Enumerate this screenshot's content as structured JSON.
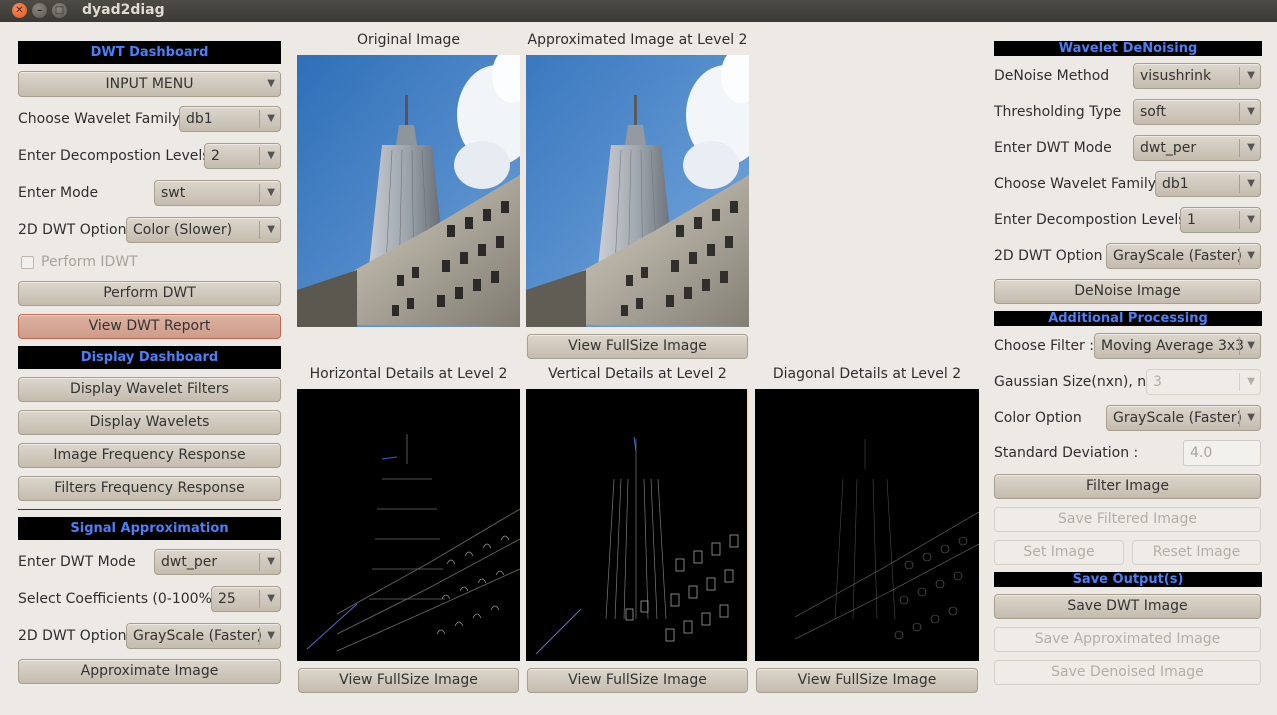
{
  "window": {
    "title": "dyad2diag",
    "close_icon": "close-icon",
    "minimize_icon": "minimize-icon",
    "maximize_icon": "maximize-icon"
  },
  "left": {
    "dwt_dashboard": {
      "header": "DWT Dashboard",
      "input_menu": "INPUT MENU",
      "wavelet_family_label": "Choose Wavelet Family",
      "wavelet_family_value": "db1",
      "decomp_levels_label": "Enter Decompostion Levels",
      "decomp_levels_value": "2",
      "mode_label": "Enter Mode",
      "mode_value": "swt",
      "dwt_option_label": "2D DWT Option",
      "dwt_option_value": "Color (Slower)",
      "perform_idwt_label": "Perform IDWT",
      "perform_dwt_button": "Perform DWT",
      "view_report_button": "View DWT Report"
    },
    "display_dashboard": {
      "header": "Display Dashboard",
      "buttons": [
        "Display Wavelet Filters",
        "Display Wavelets",
        "Image Frequency Response",
        "Filters Frequency Response"
      ]
    },
    "signal_approximation": {
      "header": "Signal Approximation",
      "dwt_mode_label": "Enter DWT Mode",
      "dwt_mode_value": "dwt_per",
      "coefficients_label": "Select Coefficients (0-100%)",
      "coefficients_value": "25",
      "dwt_option_label": "2D DWT Option",
      "dwt_option_value": "GrayScale (Faster)",
      "approximate_button": "Approximate Image"
    }
  },
  "center": {
    "original_caption": "Original Image",
    "approx_caption": "Approximated Image at Level 2",
    "horizontal_caption": "Horizontal Details at Level 2",
    "vertical_caption": "Vertical Details at Level 2",
    "diagonal_caption": "Diagonal Details at Level 2",
    "view_fullsize_button": "View FullSize Image"
  },
  "right": {
    "denoising": {
      "header": "Wavelet DeNoising",
      "method_label": "DeNoise Method",
      "method_value": "visushrink",
      "threshold_label": "Thresholding Type",
      "threshold_value": "soft",
      "dwt_mode_label": "Enter DWT Mode",
      "dwt_mode_value": "dwt_per",
      "wavelet_family_label": "Choose Wavelet Family",
      "wavelet_family_value": "db1",
      "decomp_levels_label": "Enter Decompostion Levels",
      "decomp_levels_value": "1",
      "dwt_option_label": "2D DWT Option",
      "dwt_option_value": "GrayScale (Faster)",
      "denoise_button": "DeNoise Image"
    },
    "additional": {
      "header": "Additional Processing",
      "filter_label": "Choose Filter :",
      "filter_value": "Moving Average 3x3",
      "gaussian_label": "Gaussian Size(nxn), n:",
      "gaussian_value": "3",
      "color_label": "Color Option",
      "color_value": "GrayScale (Faster)",
      "std_label": "Standard Deviation :",
      "std_value": "4.0",
      "filter_button": "Filter Image",
      "save_filtered_button": "Save Filtered Image",
      "set_image_button": "Set Image",
      "reset_image_button": "Reset Image"
    },
    "save_output": {
      "header": "Save Output(s)",
      "save_dwt_button": "Save DWT Image",
      "save_approx_button": "Save Approximated Image",
      "save_denoised_button": "Save Denoised Image"
    }
  },
  "colors": {
    "header_bg": "#000000",
    "header_text": "#4a7ff7",
    "highlight_button": "#cf9c8a"
  }
}
